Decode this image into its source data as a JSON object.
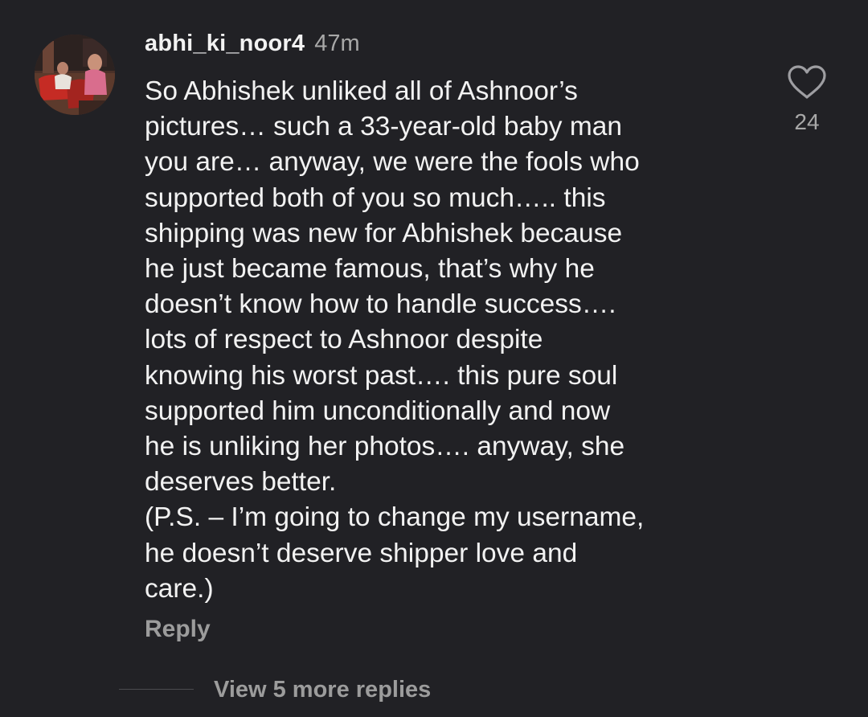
{
  "comment": {
    "username": "abhi_ki_noor4",
    "timestamp": "47m",
    "body_lines": [
      "So Abhishek unliked all of Ashnoor’s",
      "pictures… such a 33-year-old baby man",
      "you are… anyway, we were the fools who",
      "supported both of you so much….. this",
      "shipping was new for Abhishek because",
      "he just became famous, that’s why he",
      "doesn’t know how to handle success….",
      "lots of respect to Ashnoor despite",
      "knowing his worst past…. this pure soul",
      "supported him unconditionally and now",
      "he is unliking her photos…. anyway, she",
      "deserves better.",
      "(P.S. – I’m going to change my username,",
      "he doesn’t deserve shipper love and",
      "care.)"
    ],
    "like_count": "24",
    "reply_label": "Reply",
    "view_replies_label": "View 5 more replies"
  },
  "icons": {
    "like": "heart-outline-icon",
    "avatar": "user-avatar-photo"
  },
  "colors": {
    "background": "#212125",
    "text_primary": "#f2f2f2",
    "text_secondary": "#a8a8a8",
    "text_muted": "#9c9c9c"
  }
}
